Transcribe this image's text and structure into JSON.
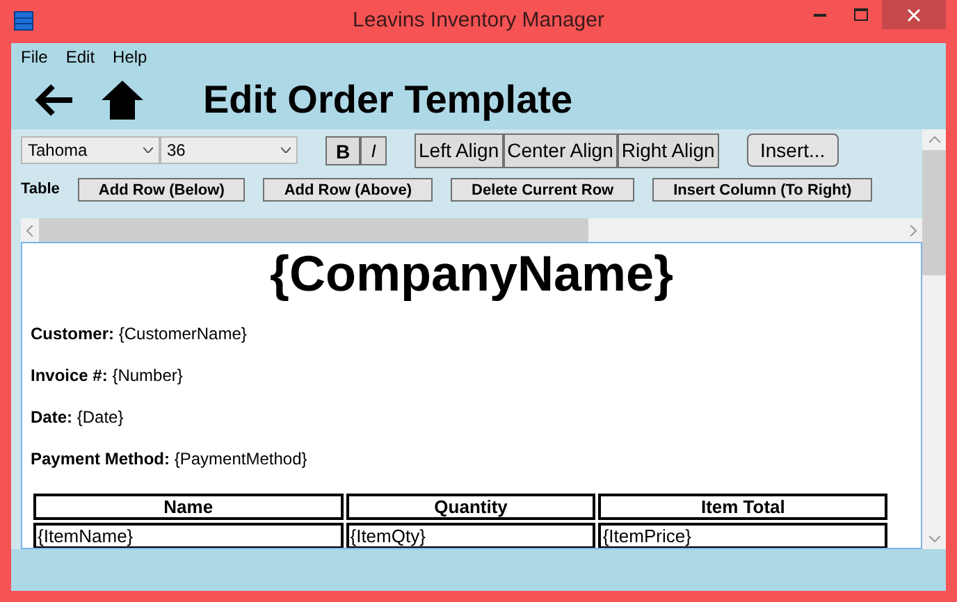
{
  "window": {
    "title": "Leavins Inventory Manager"
  },
  "menu": [
    "File",
    "Edit",
    "Help"
  ],
  "header": {
    "title": "Edit Order Template"
  },
  "toolbar": {
    "font": "Tahoma",
    "size": "36",
    "bold": "B",
    "italic": "I",
    "align_buttons": [
      "Left Align",
      "Center Align",
      "Right Align"
    ],
    "insert": "Insert..."
  },
  "table_toolbar": {
    "label": "Table",
    "buttons": [
      "Add Row (Below)",
      "Add Row (Above)",
      "Delete Current Row",
      "Insert Column (To Right)"
    ]
  },
  "document": {
    "heading": "{CompanyName}",
    "fields": [
      {
        "label": "Customer:",
        "value": "{CustomerName}"
      },
      {
        "label": "Invoice #:",
        "value": "{Number}"
      },
      {
        "label": "Date:",
        "value": "{Date}"
      },
      {
        "label": "Payment Method:",
        "value": "{PaymentMethod}"
      }
    ],
    "table": {
      "columns": [
        "Name",
        "Quantity",
        "Item Total"
      ],
      "rows": [
        [
          "{ItemName}",
          "{ItemQty}",
          "{ItemPrice}"
        ]
      ]
    }
  }
}
